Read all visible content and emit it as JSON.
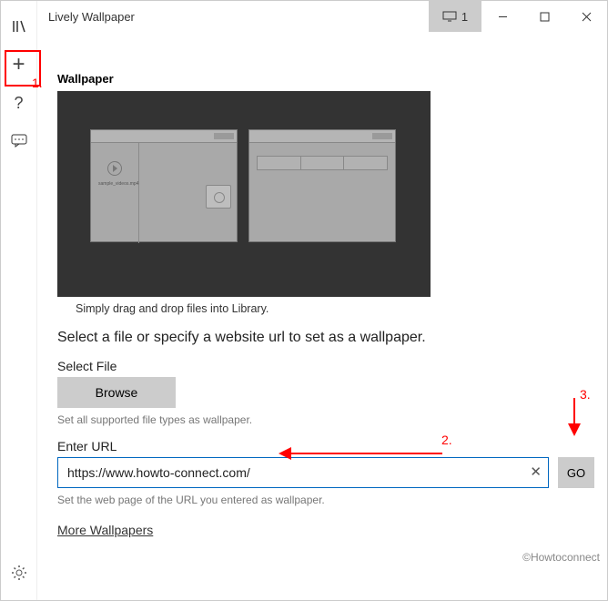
{
  "title": "Lively Wallpaper",
  "monitor_label": "1",
  "sidebar": {
    "library": "Library",
    "add": "Add",
    "help": "Help",
    "feedback": "Feedback",
    "settings": "Settings"
  },
  "section_title": "Wallpaper",
  "preview_caption": "Simply drag and drop files into Library.",
  "instruction": "Select a file or specify a website url to set as a wallpaper.",
  "select_file": {
    "label": "Select File",
    "button": "Browse",
    "hint": "Set all supported file types as wallpaper."
  },
  "enter_url": {
    "label": "Enter URL",
    "value": "https://www.howto-connect.com/",
    "go": "GO",
    "hint": "Set the web page of the URL you entered as wallpaper."
  },
  "more_link": "More Wallpapers",
  "annotations": {
    "a1": "1.",
    "a2": "2.",
    "a3": "3."
  },
  "watermark": "©Howtoconnect"
}
